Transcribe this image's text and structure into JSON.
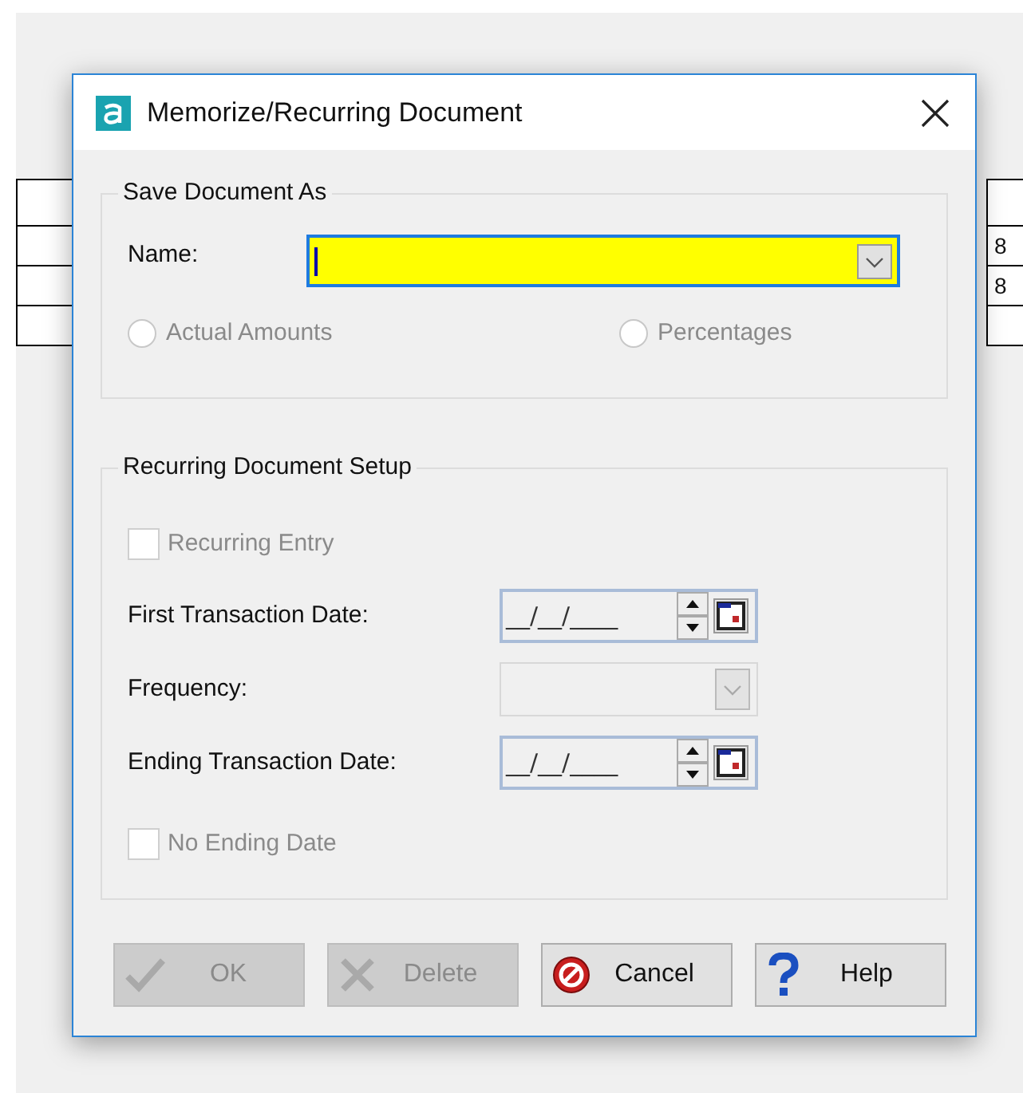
{
  "background_table": {
    "right_cells": [
      "8",
      "8"
    ]
  },
  "window": {
    "title": "Memorize/Recurring Document"
  },
  "save_document_as": {
    "title": "Save Document As",
    "name_label": "Name:",
    "name_focused": true,
    "options": [
      {
        "label": "Actual Amounts",
        "selected": false,
        "disabled": true
      },
      {
        "label": "Percentages",
        "selected": false,
        "disabled": true
      }
    ]
  },
  "recurring_setup": {
    "title": "Recurring Document Setup",
    "fields": [
      {
        "kind": "checkbox",
        "label": "Recurring Entry",
        "checked": false,
        "disabled": true
      },
      {
        "kind": "date",
        "label": "First Transaction Date:",
        "value": "__/__/____"
      },
      {
        "kind": "dropdown",
        "label": "Frequency:",
        "disabled": true
      },
      {
        "kind": "date",
        "label": "Ending Transaction Date:",
        "value": "__/__/____"
      },
      {
        "kind": "checkbox",
        "label": "No Ending Date",
        "checked": false,
        "disabled": true
      }
    ]
  },
  "buttons": [
    {
      "kind": "ok",
      "label": "OK",
      "disabled": true
    },
    {
      "kind": "delete",
      "label": "Delete",
      "disabled": true
    },
    {
      "kind": "cancel",
      "label": "Cancel",
      "disabled": false
    },
    {
      "kind": "help",
      "label": "Help",
      "disabled": false
    }
  ]
}
